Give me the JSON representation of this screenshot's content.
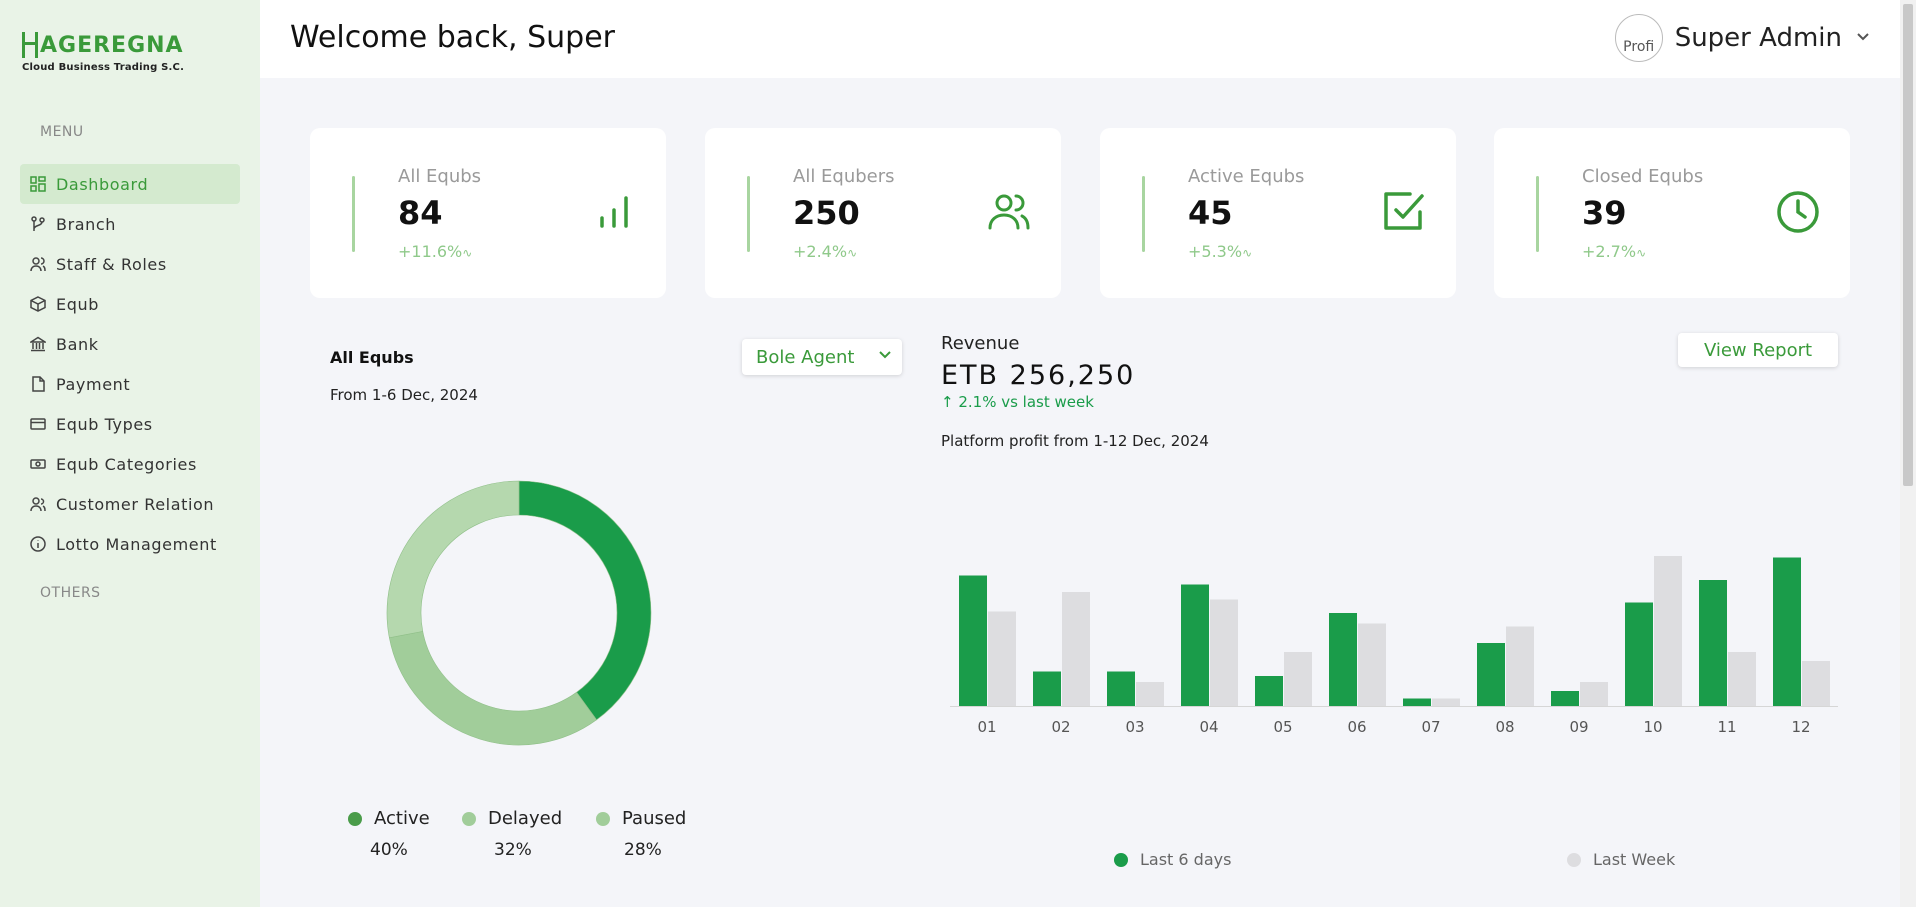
{
  "brand": {
    "name": "AGEREGNA",
    "subtitle": "Cloud  Business Trading S.C."
  },
  "sidebar": {
    "menu_heading": "MENU",
    "others_heading": "OTHERS",
    "items": [
      {
        "label": "Dashboard",
        "icon": "dashboard-icon",
        "active": true
      },
      {
        "label": "Branch",
        "icon": "branch-icon"
      },
      {
        "label": "Staff & Roles",
        "icon": "users-icon"
      },
      {
        "label": "Equb",
        "icon": "box-icon"
      },
      {
        "label": "Bank",
        "icon": "bank-icon"
      },
      {
        "label": "Payment",
        "icon": "document-icon"
      },
      {
        "label": "Equb Types",
        "icon": "card-icon"
      },
      {
        "label": "Equb Categories",
        "icon": "cash-icon"
      },
      {
        "label": "Customer Relation",
        "icon": "user-icon"
      },
      {
        "label": "Lotto Management",
        "icon": "info-icon"
      }
    ]
  },
  "header": {
    "welcome": "Welcome back, Super",
    "user_name": "Super Admin",
    "avatar_alt": "Profi"
  },
  "stats": [
    {
      "title": "All Equbs",
      "value": "84",
      "change": "+11.6%",
      "icon": "bar-chart-icon"
    },
    {
      "title": "All Equbers",
      "value": "250",
      "change": "+2.4%",
      "icon": "users-icon"
    },
    {
      "title": "Active Equbs",
      "value": "45",
      "change": "+5.3%",
      "icon": "checkbox-icon"
    },
    {
      "title": "Closed Equbs",
      "value": "39",
      "change": "+2.7%",
      "icon": "clock-icon"
    }
  ],
  "donut": {
    "title": "All Equbs",
    "subtitle": "From 1-6 Dec, 2024",
    "filter": "Bole Agent",
    "legend": [
      {
        "label": "Active",
        "pct": "40%",
        "color": "#1a9c4a"
      },
      {
        "label": "Delayed",
        "pct": "32%",
        "color": "#a1cd9a"
      },
      {
        "label": "Paused",
        "pct": "28%",
        "color": "#b5d8ae"
      }
    ]
  },
  "revenue": {
    "title": "Revenue",
    "value": "ETB 256,250",
    "change": "↑ 2.1% vs last week",
    "subtitle": "Platform profit from 1-12 Dec, 2024",
    "button": "View Report",
    "legend": [
      {
        "label": "Last 6 days",
        "color": "#1a9c4a"
      },
      {
        "label": "Last Week",
        "color": "#dddde0"
      }
    ]
  },
  "chart_data": [
    {
      "type": "pie",
      "labels": [
        "Active",
        "Delayed",
        "Paused"
      ],
      "values": [
        40,
        32,
        28
      ],
      "colors": [
        "#1a9c4a",
        "#a1cd9a",
        "#b5d8ae"
      ]
    },
    {
      "type": "bar",
      "categories": [
        "01",
        "02",
        "03",
        "04",
        "05",
        "06",
        "07",
        "08",
        "09",
        "10",
        "11",
        "12"
      ],
      "series": [
        {
          "name": "Last 6 days",
          "color": "#1a9c4a",
          "values": [
            87,
            23,
            23,
            81,
            20,
            62,
            5,
            42,
            10,
            69,
            84,
            99
          ]
        },
        {
          "name": "Last Week",
          "color": "#dddde0",
          "values": [
            63,
            76,
            16,
            71,
            36,
            55,
            5,
            53,
            16,
            100,
            36,
            30
          ]
        }
      ],
      "ylim": [
        0,
        100
      ],
      "grid": false
    }
  ]
}
